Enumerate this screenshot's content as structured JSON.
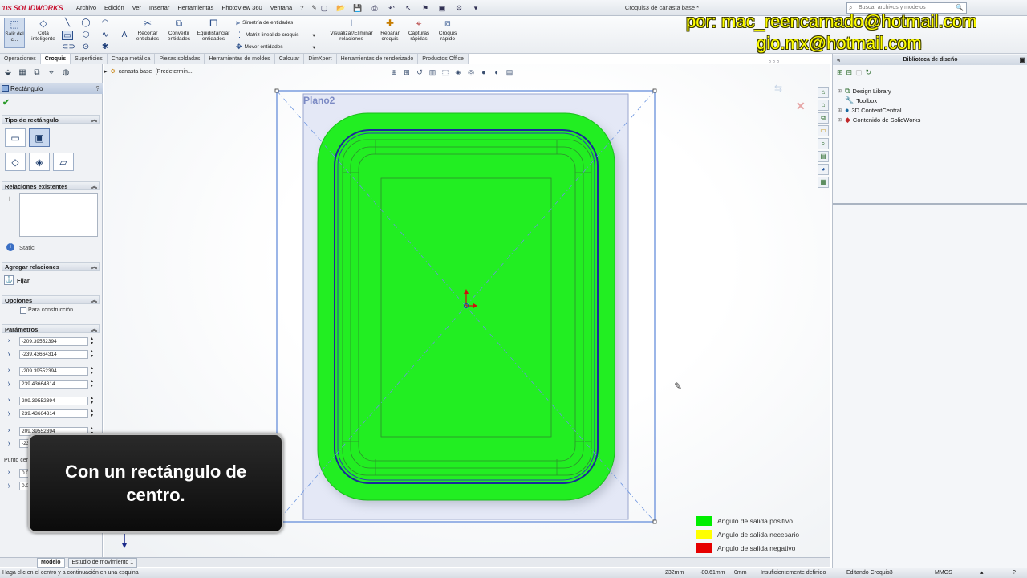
{
  "app": {
    "brand": "SOLIDWORKS",
    "window_title": "Croquis3 de canasta base *"
  },
  "menu": [
    "Archivo",
    "Edición",
    "Ver",
    "Insertar",
    "Herramientas",
    "PhotoView 360",
    "Ventana",
    "?"
  ],
  "search": {
    "placeholder": "Buscar archivos y modelos"
  },
  "ribbon": {
    "exit_sketch": "Salir del c...",
    "smart_dim": "Cota inteligente",
    "trim": "Recortar entidades",
    "convert": "Convertir entidades",
    "offset": "Equidistanciar entidades",
    "mirror": "Simetría de entidades",
    "linear_pattern": "Matriz lineal de croquis",
    "move": "Mover entidades",
    "relations": "Visualizar/Eliminar relaciones",
    "repair": "Reparar croquis",
    "quick_snaps": "Capturas rápidas",
    "rapid_sketch": "Croquis rápido"
  },
  "tabs": [
    "Operaciones",
    "Croquis",
    "Superficies",
    "Chapa metálica",
    "Piezas soldadas",
    "Herramientas de moldes",
    "Calcular",
    "DimXpert",
    "Herramientas de renderizado",
    "Productos Office"
  ],
  "active_tab": "Croquis",
  "feature_tree": {
    "part": "canasta base",
    "config": "(Predetermin..."
  },
  "property_manager": {
    "title": "Rectángulo",
    "help": "?",
    "section_type": "Tipo de rectángulo",
    "section_relations": "Relaciones existentes",
    "status_text": "Static",
    "section_add_relations": "Agregar relaciones",
    "fix_label": "Fijar",
    "section_options": "Opciones",
    "construction_label": "Para construcción",
    "section_params": "Parámetros",
    "params": [
      "-209.39552394",
      "-239.43664314",
      "-209.39552394",
      "239.43664314",
      "209.39552394",
      "239.43664314",
      "209.39552394",
      "-23"
    ],
    "center_label": "Punto cer",
    "center_values": [
      "0.0",
      "0.0"
    ],
    "label_x": "x",
    "label_y": "y"
  },
  "viewport": {
    "plane_label": "Plano2",
    "legend": [
      {
        "label": "Angulo de salida positivo",
        "color": "#00ee00"
      },
      {
        "label": "Angulo de salida necesario",
        "color": "#ffff00"
      },
      {
        "label": "Angulo de salida negativo",
        "color": "#e60000"
      }
    ]
  },
  "task_pane": {
    "title": "Biblioteca de diseño",
    "items": [
      "Design Library",
      "Toolbox",
      "3D ContentCentral",
      "Contenido de SolidWorks"
    ]
  },
  "bottom_tabs": [
    "Modelo",
    "Estudio de movimiento 1"
  ],
  "status_bar": {
    "hint": "Haga clic en el centro y a continuación en una esquina",
    "x": "232mm",
    "y": "-80.61mm",
    "z": "0mm",
    "definition": "Insuficientemente definido",
    "editing": "Editando Croquis3",
    "units": "MMGS"
  },
  "watermark": {
    "line1": "por: mac_reencarnado@hotmail.com",
    "line2": "gio.mx@hotmail.com"
  },
  "caption": "Con un rectángulo de centro."
}
